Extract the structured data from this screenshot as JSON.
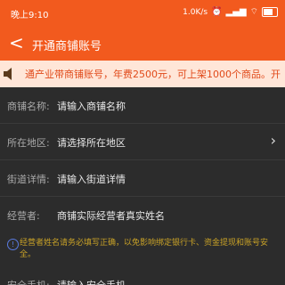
{
  "status": {
    "time": "晚上9:10",
    "speed": "1.0K/s"
  },
  "header": {
    "back": "<",
    "title": "开通商铺账号"
  },
  "notice": {
    "text": "通产业带商铺账号，年费2500元，可上架1000个商品。开"
  },
  "form": {
    "name": {
      "label": "商铺名称:",
      "placeholder": "请输入商铺名称"
    },
    "region": {
      "label": "所在地区:",
      "placeholder": "请选择所在地区"
    },
    "street": {
      "label": "街道详情:",
      "placeholder": "请输入街道详情"
    },
    "operator": {
      "label": "经营者:",
      "placeholder": "商铺实际经营者真实姓名"
    }
  },
  "warning": {
    "text": "经营者姓名请务必填写正确，以免影响绑定银行卡、资金提现和账号安全。"
  },
  "next_row": {
    "label": "安全手机:",
    "placeholder": "请输入安全手机"
  },
  "colors": {
    "accent": "#f25a1e",
    "notice_bg": "#ffe6d8",
    "notice_text": "#e14a1a",
    "warning_text": "#c9a227"
  }
}
